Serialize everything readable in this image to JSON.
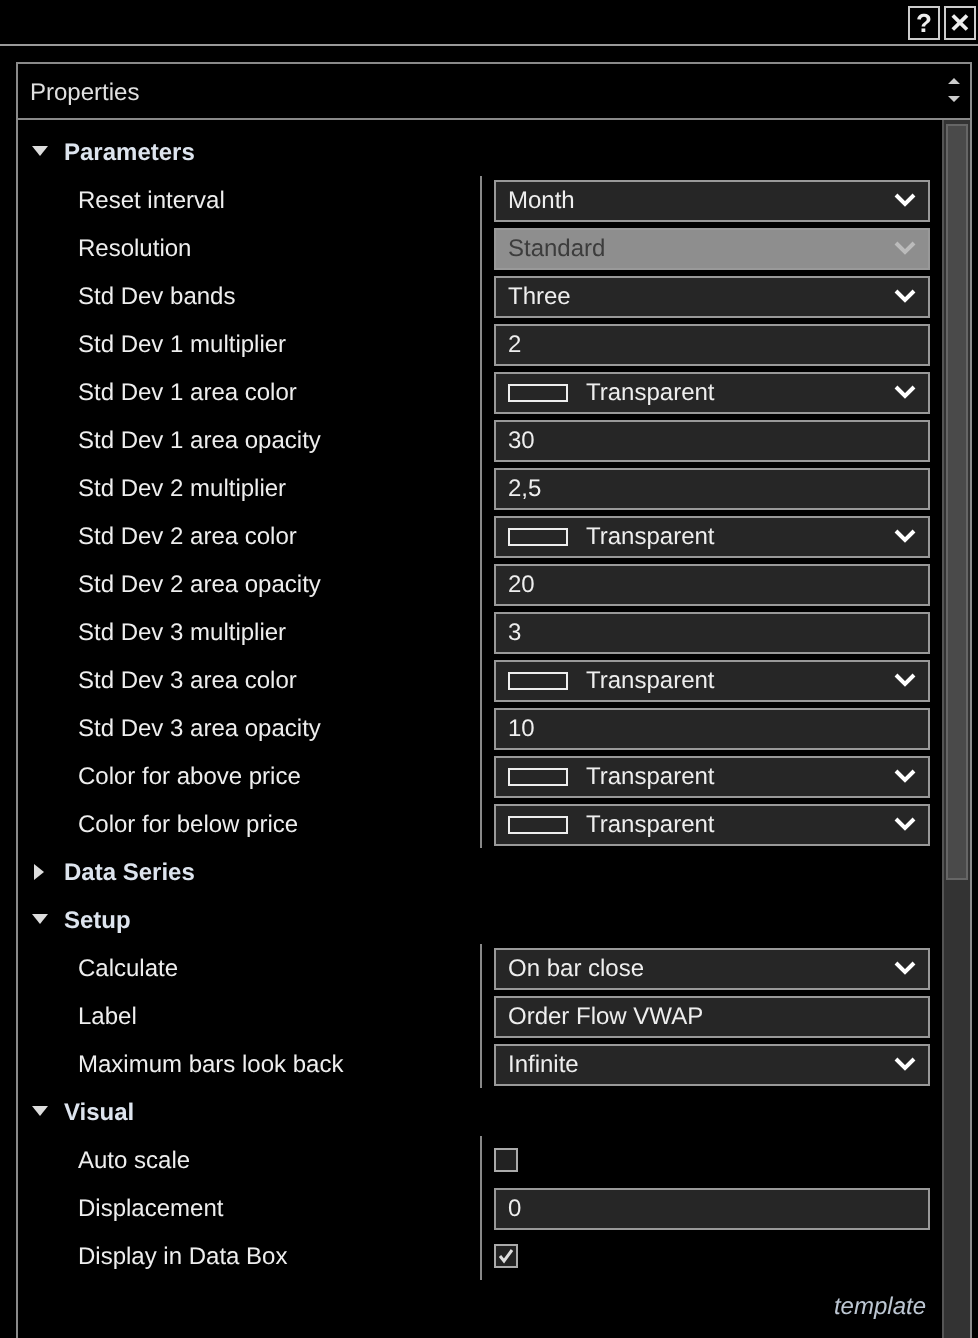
{
  "window": {
    "buttons": [
      "?",
      "✕"
    ]
  },
  "panel": {
    "title": "Properties"
  },
  "sections": [
    {
      "label": "Parameters",
      "expanded": true,
      "rows": [
        {
          "label": "Reset interval",
          "kind": "dropdown",
          "value": "Month",
          "disabled": false
        },
        {
          "label": "Resolution",
          "kind": "dropdown",
          "value": "Standard",
          "disabled": true
        },
        {
          "label": "Std Dev bands",
          "kind": "dropdown",
          "value": "Three",
          "disabled": false
        },
        {
          "label": "Std Dev 1 multiplier",
          "kind": "text",
          "value": "2"
        },
        {
          "label": "Std Dev 1 area color",
          "kind": "color",
          "value": "Transparent"
        },
        {
          "label": "Std Dev 1 area opacity",
          "kind": "text",
          "value": "30"
        },
        {
          "label": "Std Dev 2 multiplier",
          "kind": "text",
          "value": "2,5"
        },
        {
          "label": "Std Dev 2 area color",
          "kind": "color",
          "value": "Transparent"
        },
        {
          "label": "Std Dev 2 area opacity",
          "kind": "text",
          "value": "20"
        },
        {
          "label": "Std Dev 3 multiplier",
          "kind": "text",
          "value": "3"
        },
        {
          "label": "Std Dev 3 area color",
          "kind": "color",
          "value": "Transparent"
        },
        {
          "label": "Std Dev 3 area opacity",
          "kind": "text",
          "value": "10"
        },
        {
          "label": "Color for above price",
          "kind": "color",
          "value": "Transparent"
        },
        {
          "label": "Color for below price",
          "kind": "color",
          "value": "Transparent"
        }
      ]
    },
    {
      "label": "Data Series",
      "expanded": false
    },
    {
      "label": "Setup",
      "expanded": true,
      "rows": [
        {
          "label": "Calculate",
          "kind": "dropdown",
          "value": "On bar close",
          "disabled": false
        },
        {
          "label": "Label",
          "kind": "text",
          "value": "Order Flow VWAP"
        },
        {
          "label": "Maximum bars look back",
          "kind": "dropdown",
          "value": "Infinite",
          "disabled": false
        }
      ]
    },
    {
      "label": "Visual",
      "expanded": true,
      "rows": [
        {
          "label": "Auto scale",
          "kind": "checkbox",
          "checked": false
        },
        {
          "label": "Displacement",
          "kind": "text",
          "value": "0"
        },
        {
          "label": "Display in Data Box",
          "kind": "checkbox",
          "checked": true
        }
      ]
    }
  ],
  "footer": "template"
}
